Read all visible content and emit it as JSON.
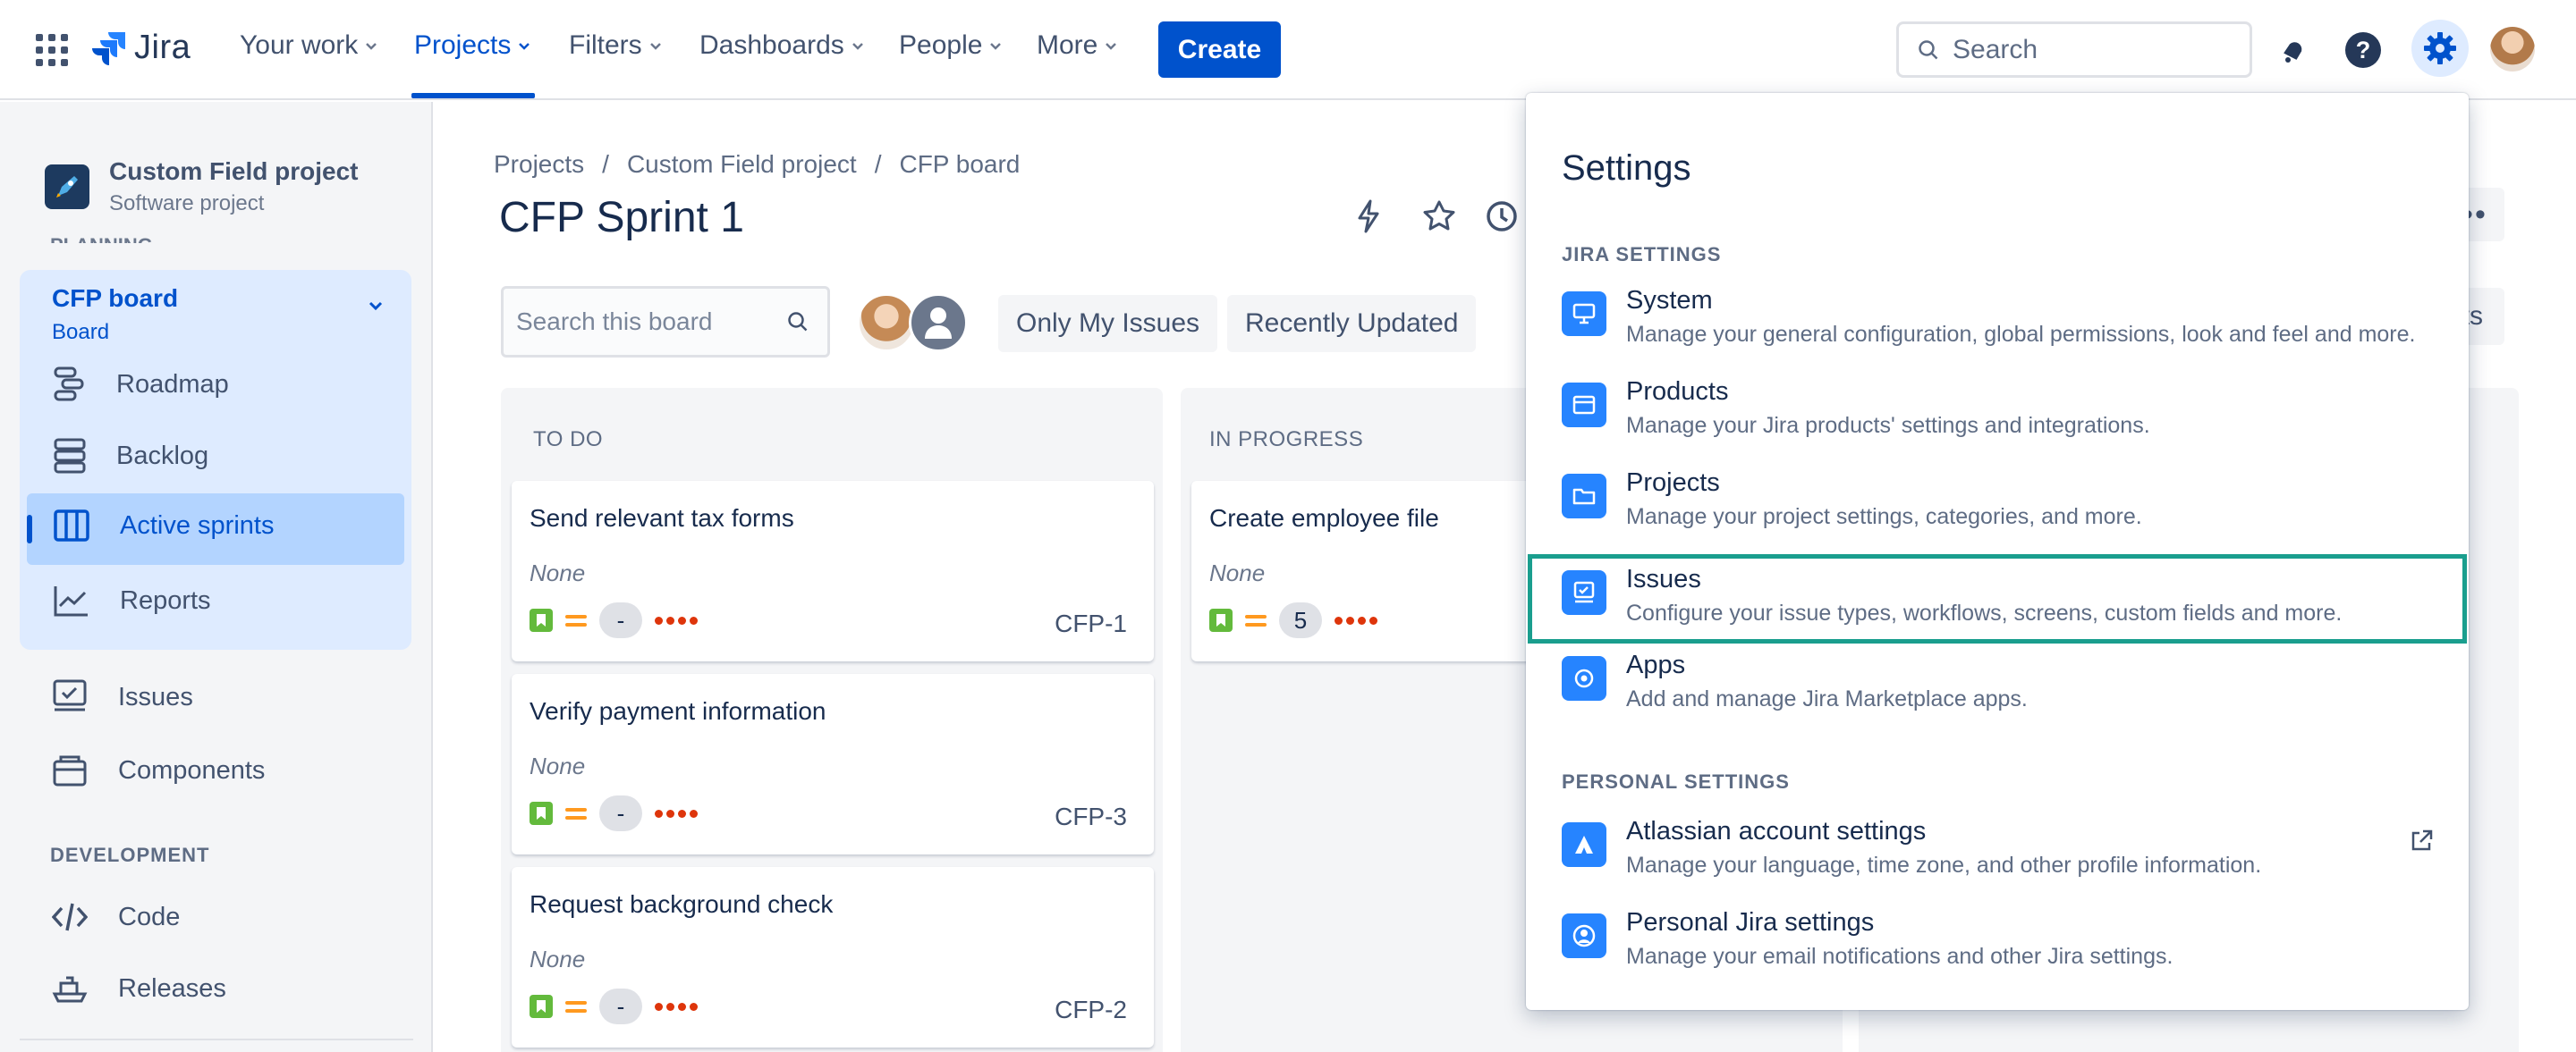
{
  "nav": {
    "logo": "Jira",
    "items": [
      {
        "label": "Your work"
      },
      {
        "label": "Projects"
      },
      {
        "label": "Filters"
      },
      {
        "label": "Dashboards"
      },
      {
        "label": "People"
      },
      {
        "label": "More"
      }
    ],
    "create_label": "Create",
    "search_placeholder": "Search"
  },
  "sidebar": {
    "project_name": "Custom Field project",
    "project_type": "Software project",
    "cut_label": "PLANNING",
    "board_title": "CFP board",
    "board_subtitle": "Board",
    "items": [
      {
        "label": "Roadmap"
      },
      {
        "label": "Backlog"
      },
      {
        "label": "Active sprints"
      },
      {
        "label": "Reports"
      },
      {
        "label": "Issues"
      },
      {
        "label": "Components"
      },
      {
        "label": "Code"
      },
      {
        "label": "Releases"
      }
    ],
    "section_development": "DEVELOPMENT"
  },
  "main": {
    "breadcrumb": [
      "Projects",
      "/",
      "Custom Field project",
      "/",
      "CFP board"
    ],
    "title": "CFP Sprint 1",
    "more_label": "•••",
    "insights_label": "ts",
    "search_placeholder": "Search this board",
    "filters": [
      "Only My Issues",
      "Recently Updated"
    ],
    "columns": [
      {
        "title": "TO DO",
        "cards": [
          {
            "title": "Send relevant tax forms",
            "sub": "None",
            "estimate": "-",
            "key": "CFP-1"
          },
          {
            "title": "Verify payment information",
            "sub": "None",
            "estimate": "-",
            "key": "CFP-3"
          },
          {
            "title": "Request background check",
            "sub": "None",
            "estimate": "-",
            "key": "CFP-2"
          }
        ]
      },
      {
        "title": "IN PROGRESS",
        "cards": [
          {
            "title": "Create employee file",
            "sub": "None",
            "estimate": "5",
            "key": ""
          }
        ]
      }
    ]
  },
  "settings": {
    "title": "Settings",
    "jira_section": "JIRA SETTINGS",
    "personal_section": "PERSONAL SETTINGS",
    "jira_items": [
      {
        "name": "System",
        "desc": "Manage your general configuration, global permissions, look and feel and more.",
        "icon": "monitor-icon"
      },
      {
        "name": "Products",
        "desc": "Manage your Jira products' settings and integrations.",
        "icon": "window-icon"
      },
      {
        "name": "Projects",
        "desc": "Manage your project settings, categories, and more.",
        "icon": "folder-icon"
      },
      {
        "name": "Issues",
        "desc": "Configure your issue types, workflows, screens, custom fields and more.",
        "icon": "issues-icon"
      },
      {
        "name": "Apps",
        "desc": "Add and manage Jira Marketplace apps.",
        "icon": "apps-icon"
      }
    ],
    "personal_items": [
      {
        "name": "Atlassian account settings",
        "desc": "Manage your language, time zone, and other profile information.",
        "icon": "atlassian-icon"
      },
      {
        "name": "Personal Jira settings",
        "desc": "Manage your email notifications and other Jira settings.",
        "icon": "person-icon"
      }
    ]
  },
  "colors": {
    "primary": "#0052cc",
    "highlight_outline": "#1a9e8e",
    "settings_icon": "#2684ff",
    "story": "#63ba3c",
    "priority_medium": "#ff991f"
  }
}
